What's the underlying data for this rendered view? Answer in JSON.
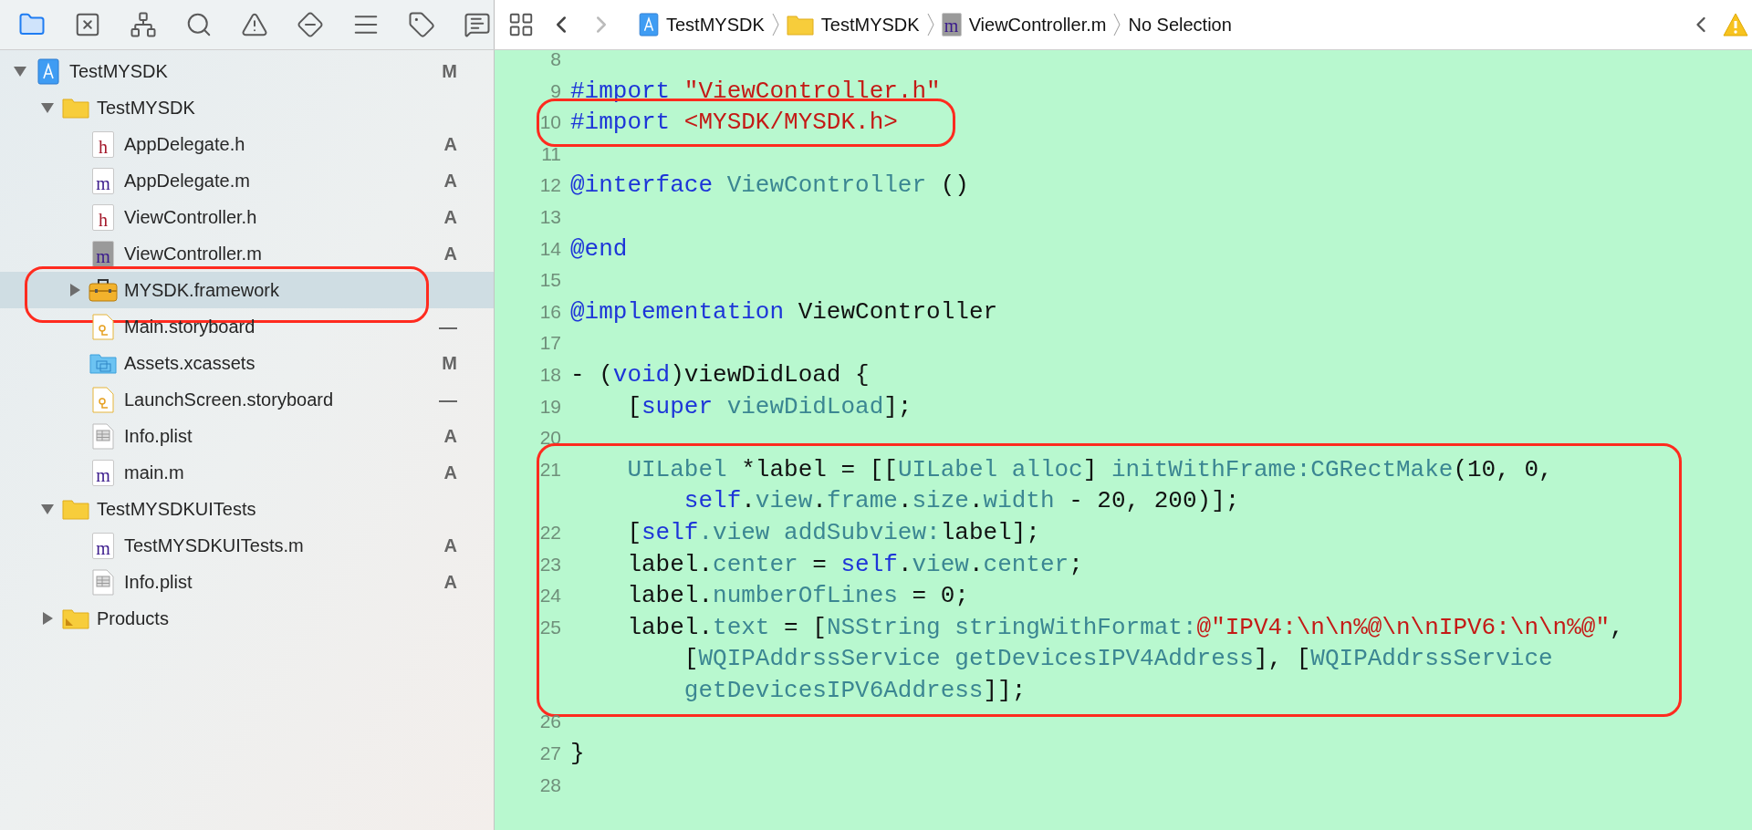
{
  "navigator_tabs": [
    {
      "selected": true
    },
    {
      "selected": false
    },
    {
      "selected": false
    },
    {
      "selected": false
    },
    {
      "selected": false
    },
    {
      "selected": false
    },
    {
      "selected": false
    },
    {
      "selected": false
    },
    {
      "selected": false
    }
  ],
  "jump_bar": {
    "back_enabled": true,
    "forward_enabled": false,
    "breadcrumbs": [
      {
        "label": "TestMYSDK",
        "kind": "project"
      },
      {
        "label": "TestMYSDK",
        "kind": "folder"
      },
      {
        "label": "ViewController.m",
        "kind": "source_open",
        "icon_glyph": "m"
      },
      {
        "label": "No Selection",
        "kind": "symbol"
      }
    ],
    "issues": {
      "warning": true
    }
  },
  "sidebar": {
    "tree": [
      {
        "label": "TestMYSDK",
        "kind": "project",
        "status": "M",
        "expanded": true,
        "selected": false,
        "children": [
          {
            "label": "TestMYSDK",
            "kind": "folder",
            "expanded": true,
            "selected": false,
            "children": [
              {
                "label": "AppDelegate.h",
                "kind": "header",
                "icon_glyph": "h",
                "status": "A",
                "selected": false
              },
              {
                "label": "AppDelegate.m",
                "kind": "source",
                "icon_glyph": "m",
                "status": "A",
                "selected": false
              },
              {
                "label": "ViewController.h",
                "kind": "header",
                "icon_glyph": "h",
                "status": "A",
                "selected": false
              },
              {
                "label": "ViewController.m",
                "kind": "source_open",
                "icon_glyph": "m",
                "status": "A",
                "selected": false
              },
              {
                "label": "MYSDK.framework",
                "kind": "framework",
                "expanded": false,
                "selected": true,
                "annotated": true
              },
              {
                "label": "Main.storyboard",
                "kind": "storyboard",
                "status": "—",
                "selected": false
              },
              {
                "label": "Assets.xcassets",
                "kind": "assets",
                "status": "M",
                "selected": false
              },
              {
                "label": "LaunchScreen.storyboard",
                "kind": "storyboard",
                "status": "—",
                "selected": false
              },
              {
                "label": "Info.plist",
                "kind": "plist",
                "status": "A",
                "selected": false
              },
              {
                "label": "main.m",
                "kind": "source",
                "icon_glyph": "m",
                "status": "A",
                "selected": false
              }
            ]
          },
          {
            "label": "TestMYSDKUITests",
            "kind": "folder",
            "expanded": true,
            "selected": false,
            "children": [
              {
                "label": "TestMYSDKUITests.m",
                "kind": "source",
                "icon_glyph": "m",
                "status": "A",
                "selected": false
              },
              {
                "label": "Info.plist",
                "kind": "plist",
                "status": "A",
                "selected": false
              }
            ]
          },
          {
            "label": "Products",
            "kind": "products",
            "expanded": false,
            "selected": false
          }
        ]
      }
    ]
  },
  "code_blocks": [
    {
      "lines": [
        {
          "number": "8"
        },
        {
          "number": "9",
          "rows": [
            {
              "segments": [
                {
                  "kind": "keyword",
                  "text": "#import"
                },
                {
                  "kind": "string",
                  "text": " \"ViewController.h\""
                }
              ]
            }
          ]
        }
      ]
    },
    {
      "annotated": true,
      "lines": [
        {
          "number": "10",
          "rows": [
            {
              "segments": [
                {
                  "kind": "keyword",
                  "text": "#import"
                },
                {
                  "kind": "string",
                  "text": " <MYSDK/MYSDK.h>"
                }
              ]
            }
          ]
        }
      ]
    },
    {
      "lines": [
        {
          "number": "11"
        },
        {
          "number": "12",
          "rows": [
            {
              "segments": [
                {
                  "kind": "keyword",
                  "text": "@interface"
                },
                {
                  "kind": "identifier",
                  "text": " ViewController"
                },
                {
                  "kind": "plain",
                  "text": " ()"
                }
              ]
            }
          ]
        },
        {
          "number": "13"
        },
        {
          "number": "14",
          "rows": [
            {
              "segments": [
                {
                  "kind": "keyword",
                  "text": "@end"
                }
              ]
            }
          ]
        },
        {
          "number": "15"
        },
        {
          "number": "16",
          "rows": [
            {
              "segments": [
                {
                  "kind": "keyword",
                  "text": "@implementation"
                },
                {
                  "kind": "plain",
                  "text": " ViewController"
                }
              ]
            }
          ]
        },
        {
          "number": "17"
        },
        {
          "number": "18",
          "rows": [
            {
              "segments": [
                {
                  "kind": "plain",
                  "text": "- ("
                },
                {
                  "kind": "keyword",
                  "text": "void"
                },
                {
                  "kind": "plain",
                  "text": ")viewDidLoad {"
                }
              ]
            }
          ]
        },
        {
          "number": "19",
          "rows": [
            {
              "segments": [
                {
                  "kind": "plain",
                  "text": "    ["
                },
                {
                  "kind": "keyword",
                  "text": "super"
                },
                {
                  "kind": "identifier",
                  "text": " viewDidLoad"
                },
                {
                  "kind": "plain",
                  "text": "];"
                }
              ]
            }
          ]
        },
        {
          "number": "20"
        }
      ]
    },
    {
      "annotated": true,
      "lines": [
        {
          "number": "21",
          "rows": [
            {
              "segments": [
                {
                  "kind": "identifier",
                  "text": "    UILabel"
                },
                {
                  "kind": "plain",
                  "text": " *label = [["
                },
                {
                  "kind": "identifier",
                  "text": "UILabel alloc"
                },
                {
                  "kind": "plain",
                  "text": "] "
                },
                {
                  "kind": "identifier",
                  "text": "initWithFrame:CGRectMake"
                },
                {
                  "kind": "plain",
                  "text": "(10, 0,"
                }
              ]
            },
            {
              "segments": [
                {
                  "kind": "keyword",
                  "text": "        self"
                },
                {
                  "kind": "plain",
                  "text": "."
                },
                {
                  "kind": "identifier",
                  "text": "view"
                },
                {
                  "kind": "plain",
                  "text": "."
                },
                {
                  "kind": "identifier",
                  "text": "frame"
                },
                {
                  "kind": "plain",
                  "text": "."
                },
                {
                  "kind": "identifier",
                  "text": "size"
                },
                {
                  "kind": "plain",
                  "text": "."
                },
                {
                  "kind": "identifier",
                  "text": "width"
                },
                {
                  "kind": "plain",
                  "text": " - 20, 200)];"
                }
              ]
            }
          ]
        },
        {
          "number": "22",
          "rows": [
            {
              "segments": [
                {
                  "kind": "plain",
                  "text": "    ["
                },
                {
                  "kind": "keyword",
                  "text": "self"
                },
                {
                  "kind": "identifier",
                  "text": ".view addSubview:"
                },
                {
                  "kind": "plain",
                  "text": "label];"
                }
              ]
            }
          ]
        },
        {
          "number": "23",
          "rows": [
            {
              "segments": [
                {
                  "kind": "plain",
                  "text": "    label."
                },
                {
                  "kind": "identifier",
                  "text": "center"
                },
                {
                  "kind": "plain",
                  "text": " = "
                },
                {
                  "kind": "keyword",
                  "text": "self"
                },
                {
                  "kind": "plain",
                  "text": "."
                },
                {
                  "kind": "identifier",
                  "text": "view"
                },
                {
                  "kind": "plain",
                  "text": "."
                },
                {
                  "kind": "identifier",
                  "text": "center"
                },
                {
                  "kind": "plain",
                  "text": ";"
                }
              ]
            }
          ]
        },
        {
          "number": "24",
          "rows": [
            {
              "segments": [
                {
                  "kind": "plain",
                  "text": "    label."
                },
                {
                  "kind": "identifier",
                  "text": "numberOfLines"
                },
                {
                  "kind": "plain",
                  "text": " = 0;"
                }
              ]
            }
          ]
        },
        {
          "number": "25",
          "rows": [
            {
              "segments": [
                {
                  "kind": "plain",
                  "text": "    label."
                },
                {
                  "kind": "identifier",
                  "text": "text"
                },
                {
                  "kind": "plain",
                  "text": " = ["
                },
                {
                  "kind": "identifier",
                  "text": "NSString stringWithFormat:"
                },
                {
                  "kind": "string",
                  "text": "@\"IPV4:\\n\\n%@\\n\\nIPV6:\\n\\n%@\""
                },
                {
                  "kind": "plain",
                  "text": ","
                }
              ]
            },
            {
              "segments": [
                {
                  "kind": "plain",
                  "text": "        ["
                },
                {
                  "kind": "identifier",
                  "text": "WQIPAddrssService getDevicesIPV4Address"
                },
                {
                  "kind": "plain",
                  "text": "], ["
                },
                {
                  "kind": "identifier",
                  "text": "WQIPAddrssService"
                }
              ]
            },
            {
              "segments": [
                {
                  "kind": "identifier",
                  "text": "        getDevicesIPV6Address"
                },
                {
                  "kind": "plain",
                  "text": "]];"
                }
              ]
            }
          ]
        }
      ]
    },
    {
      "lines": [
        {
          "number": "26"
        },
        {
          "number": "27",
          "rows": [
            {
              "segments": [
                {
                  "kind": "plain",
                  "text": "}"
                }
              ]
            }
          ]
        },
        {
          "number": "28"
        }
      ]
    }
  ]
}
